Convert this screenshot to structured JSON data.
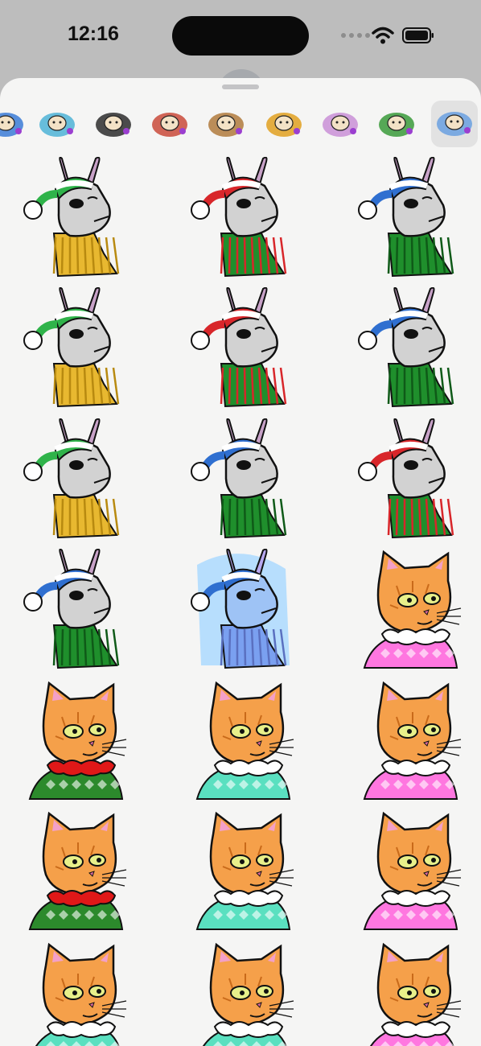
{
  "status_bar": {
    "time": "12:16"
  },
  "tray": {
    "packs": [
      {
        "name": "sticker-pack-1",
        "color": "#3b7bd6"
      },
      {
        "name": "sticker-pack-2",
        "color": "#4db3d6"
      },
      {
        "name": "sticker-pack-3",
        "color": "#2d2d2d"
      },
      {
        "name": "sticker-pack-4",
        "color": "#c94a3a"
      },
      {
        "name": "sticker-pack-5",
        "color": "#b07a3c"
      },
      {
        "name": "sticker-pack-6",
        "color": "#e0a020"
      },
      {
        "name": "sticker-pack-7",
        "color": "#c98fd6"
      },
      {
        "name": "sticker-pack-8",
        "color": "#3a9a3a"
      },
      {
        "name": "sticker-pack-9-selected",
        "color": "#6aa0e0"
      }
    ],
    "selected_index": 8
  },
  "stickers": [
    {
      "kind": "llama",
      "hat": "#2fb34a",
      "scarf": "#e8b830",
      "stripe": "#b88a10"
    },
    {
      "kind": "llama",
      "hat": "#d8262a",
      "scarf": "#1f8f2c",
      "stripe": "#d8262a"
    },
    {
      "kind": "llama",
      "hat": "#2f6fd0",
      "scarf": "#1f8f2c",
      "stripe": "#0f5a18"
    },
    {
      "kind": "llama",
      "hat": "#2fb34a",
      "scarf": "#e8b830",
      "stripe": "#b88a10"
    },
    {
      "kind": "llama",
      "hat": "#d8262a",
      "scarf": "#1f8f2c",
      "stripe": "#d8262a"
    },
    {
      "kind": "llama",
      "hat": "#2f6fd0",
      "scarf": "#1f8f2c",
      "stripe": "#0f5a18"
    },
    {
      "kind": "llama",
      "hat": "#2fb34a",
      "scarf": "#e8b830",
      "stripe": "#b88a10"
    },
    {
      "kind": "llama",
      "hat": "#2f6fd0",
      "scarf": "#1f8f2c",
      "stripe": "#0f5a18"
    },
    {
      "kind": "llama",
      "hat": "#d8262a",
      "scarf": "#1f8f2c",
      "stripe": "#d8262a"
    },
    {
      "kind": "llama",
      "hat": "#2f6fd0",
      "scarf": "#1f8f2c",
      "stripe": "#0f5a18"
    },
    {
      "kind": "llama-frozen",
      "hat": "#2f6fd0",
      "scarf": "#7aa0f0",
      "stripe": "#5a70c0"
    },
    {
      "kind": "cat",
      "sweater": "#ff77e0",
      "collar": "#ffffff"
    },
    {
      "kind": "cat",
      "sweater": "#2c8a2c",
      "collar": "#e01818"
    },
    {
      "kind": "cat",
      "sweater": "#5ae0c0",
      "collar": "#ffffff"
    },
    {
      "kind": "cat",
      "sweater": "#ff77e0",
      "collar": "#ffffff"
    },
    {
      "kind": "cat",
      "sweater": "#2c8a2c",
      "collar": "#e01818"
    },
    {
      "kind": "cat",
      "sweater": "#5ae0c0",
      "collar": "#ffffff"
    },
    {
      "kind": "cat",
      "sweater": "#ff77e0",
      "collar": "#ffffff"
    },
    {
      "kind": "cat",
      "sweater": "#5ae0c0",
      "collar": "#ffffff"
    },
    {
      "kind": "cat",
      "sweater": "#5ae0c0",
      "collar": "#ffffff"
    },
    {
      "kind": "cat",
      "sweater": "#ff77e0",
      "collar": "#ffffff"
    }
  ]
}
